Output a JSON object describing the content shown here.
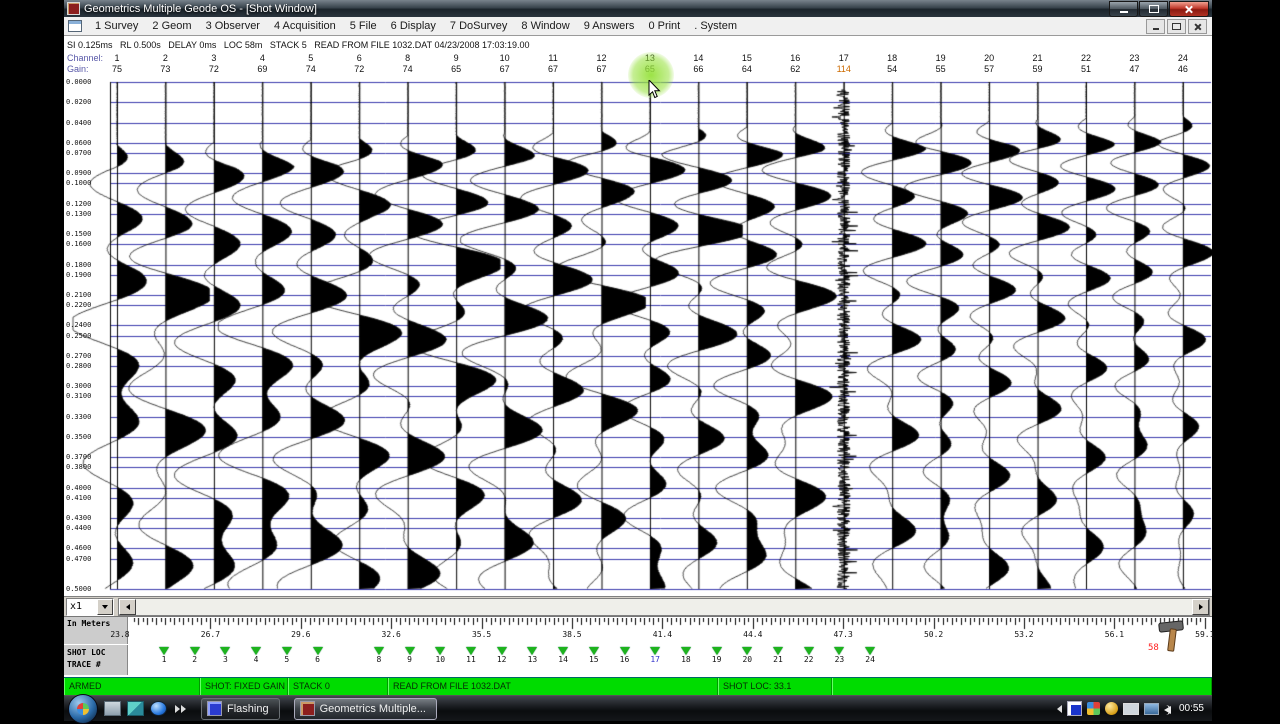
{
  "window": {
    "title": "Geometrics Multiple Geode OS - [Shot Window]"
  },
  "menu": {
    "items": [
      "1 Survey",
      "2 Geom",
      "3 Observer",
      "4 Acquisition",
      "5 File",
      "6 Display",
      "7 DoSurvey",
      "8 Window",
      "9 Answers",
      "0 Print",
      ". System"
    ]
  },
  "plot": {
    "header_info": "SI 0.125ms   RL 0.500s   DELAY 0ms   LOC 58m   STACK 5   READ FROM FILE 1032.DAT 04/23/2008 17:03:19.00",
    "channel_row_label": "Channel:",
    "gain_row_label": "Gain:",
    "channels": [
      {
        "ch": "1",
        "gain": "75"
      },
      {
        "ch": "2",
        "gain": "73"
      },
      {
        "ch": "3",
        "gain": "72"
      },
      {
        "ch": "4",
        "gain": "69"
      },
      {
        "ch": "5",
        "gain": "74"
      },
      {
        "ch": "6",
        "gain": "72"
      },
      {
        "ch": "8",
        "gain": "74"
      },
      {
        "ch": "9",
        "gain": "65"
      },
      {
        "ch": "10",
        "gain": "67"
      },
      {
        "ch": "11",
        "gain": "67"
      },
      {
        "ch": "12",
        "gain": "67"
      },
      {
        "ch": "13",
        "gain": "65"
      },
      {
        "ch": "14",
        "gain": "66"
      },
      {
        "ch": "15",
        "gain": "64"
      },
      {
        "ch": "16",
        "gain": "62"
      },
      {
        "ch": "17",
        "gain": "114"
      },
      {
        "ch": "18",
        "gain": "54"
      },
      {
        "ch": "19",
        "gain": "55"
      },
      {
        "ch": "20",
        "gain": "57"
      },
      {
        "ch": "21",
        "gain": "59"
      },
      {
        "ch": "22",
        "gain": "51"
      },
      {
        "ch": "23",
        "gain": "47"
      },
      {
        "ch": "24",
        "gain": "46"
      }
    ],
    "highlighted_channel": "13",
    "noisy_channel": "17",
    "time_labels": [
      "0.0000",
      "0.0200",
      "0.0400",
      "0.0600",
      "0.0700",
      "0.0900",
      "0.1000",
      "0.1200",
      "0.1300",
      "0.1500",
      "0.1600",
      "0.1800",
      "0.1900",
      "0.2100",
      "0.2200",
      "0.2400",
      "0.2500",
      "0.2700",
      "0.2800",
      "0.3000",
      "0.3100",
      "0.3300",
      "0.3500",
      "0.3700",
      "0.3800",
      "0.4000",
      "0.4100",
      "0.4300",
      "0.4400",
      "0.4600",
      "0.4700",
      "0.5000"
    ],
    "time_range_s": [
      0,
      0.5
    ]
  },
  "zoom_control": {
    "value": "x1"
  },
  "ruler": {
    "unit_label": "In Meters",
    "labels": [
      "23.8",
      "26.7",
      "29.6",
      "32.6",
      "35.5",
      "38.5",
      "41.4",
      "44.4",
      "47.3",
      "50.2",
      "53.2",
      "56.1",
      "59.1"
    ],
    "shot_marker": {
      "label": "58",
      "icon": "hammer-icon"
    }
  },
  "markers": {
    "shot_loc_label": "SHOT LOC",
    "trace_row_label": "TRACE #",
    "trace_numbers": [
      "1",
      "2",
      "3",
      "4",
      "5",
      "6",
      "8",
      "9",
      "10",
      "11",
      "12",
      "13",
      "14",
      "15",
      "16",
      "17",
      "18",
      "19",
      "20",
      "21",
      "22",
      "23",
      "24"
    ],
    "highlight_trace": "17"
  },
  "status_bar": {
    "segments": [
      "ARMED",
      "SHOT: FIXED GAIN",
      "STACK 0",
      "READ FROM FILE 1032.DAT",
      "SHOT LOC: 33.1",
      ""
    ]
  },
  "taskbar": {
    "buttons": [
      {
        "label": "Flashing",
        "active": false,
        "icon": "flashing-icon"
      },
      {
        "label": "Geometrics Multiple...",
        "active": true,
        "icon": "geometrics-icon"
      }
    ],
    "clock": "00:55"
  },
  "colors": {
    "status_green": "#00dc00",
    "grid_blue": "#3a3aad",
    "highlight_green": "#96e13c",
    "gain_alert_orange": "#cc6a00",
    "marker_green": "#1db31d",
    "shot_label_red": "#ff2020"
  }
}
